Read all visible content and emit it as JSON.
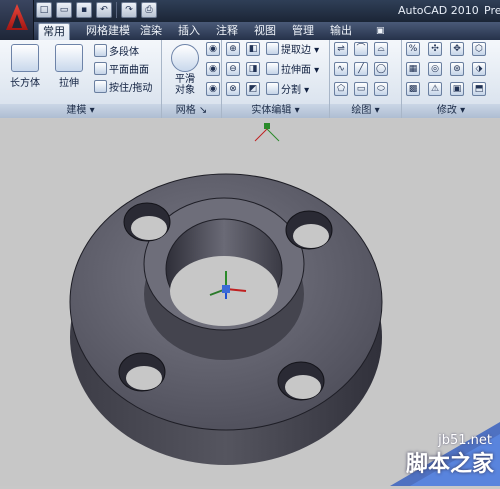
{
  "app": {
    "title": "AutoCAD 2010",
    "title_overflow": "Pre"
  },
  "quick_access": [
    {
      "icon": "new-file-icon",
      "glyph": "□"
    },
    {
      "icon": "open-folder-icon",
      "glyph": "▭"
    },
    {
      "icon": "save-icon",
      "glyph": "▪"
    },
    {
      "icon": "undo-icon",
      "glyph": "↶"
    },
    {
      "icon": "redo-icon",
      "glyph": "↷"
    },
    {
      "icon": "print-icon",
      "glyph": "⎙"
    }
  ],
  "tabs": [
    "常用",
    "网格建模",
    "渲染",
    "插入",
    "注释",
    "视图",
    "管理",
    "输出"
  ],
  "active_tab": "常用",
  "panels": {
    "modeling": {
      "label": "建模",
      "box_label": "长方体",
      "extrude_label": "拉伸",
      "polysolid_label": "多段体",
      "planar_label": "平面曲面",
      "presspull_label": "按住/拖动"
    },
    "mesh": {
      "label": "网格",
      "smooth_label": "平滑\n对象"
    },
    "solid_edit": {
      "label": "实体编辑",
      "extract_label": "提取边",
      "extrude_face_label": "拉伸面",
      "separate_label": "分割"
    },
    "draw": {
      "label": "绘图"
    },
    "modify": {
      "label": "修改"
    }
  },
  "watermark": {
    "site": "jb51.net",
    "name": "脚本之家"
  }
}
